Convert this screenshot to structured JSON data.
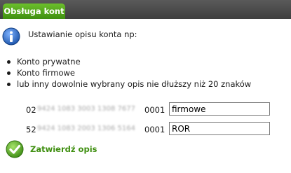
{
  "header": {
    "tab_label": "Obsługa kont"
  },
  "main": {
    "intro": "Ustawianie opisu konta np:",
    "options": [
      "Konto prywatne",
      "Konto firmowe",
      "lub inny dowolnie wybrany opis nie dłuższy niż 20 znaków"
    ],
    "accounts": [
      {
        "prefix": "02",
        "masked": "9424 1083 3003 1308 7677",
        "suffix": "0001",
        "value": "firmowe"
      },
      {
        "prefix": "52",
        "masked": "9424 1083 2003 1306 5164",
        "suffix": "0001",
        "value": "ROR"
      }
    ],
    "confirm_label": "Zatwierdź opis"
  },
  "colors": {
    "accent_green": "#3f8f10",
    "info_blue": "#1f5fb5",
    "topbar": "#4a4a4a"
  },
  "icons": {
    "info": "info-icon",
    "confirm": "checkmark-icon"
  }
}
